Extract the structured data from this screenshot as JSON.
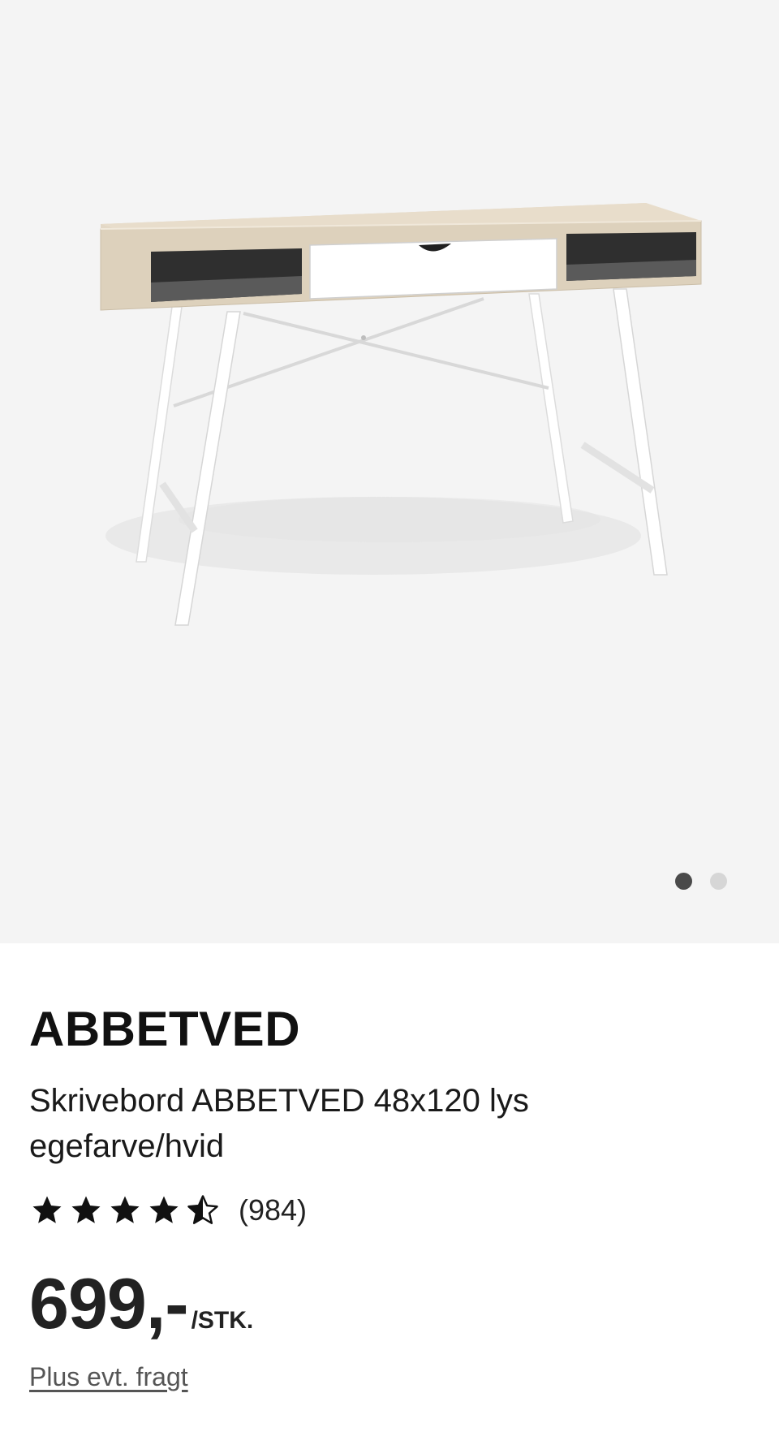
{
  "gallery": {
    "image_label": "Skrivebord ABBETVED 48x120 lys egefarve/hvid",
    "image_count": 2,
    "active_index": 0,
    "colors": {
      "background": "#f4f4f4",
      "dot_active": "#4a4a4a",
      "dot_inactive": "#d6d6d6"
    }
  },
  "product": {
    "brand": "ABBETVED",
    "description": "Skrivebord ABBETVED 48x120 lys egefarve/hvid",
    "rating": {
      "value": 4.5,
      "max": 5,
      "count_label": "(984)"
    },
    "price": "699,-",
    "unit": "/STK.",
    "shipping_note": "Plus evt. fragt"
  }
}
